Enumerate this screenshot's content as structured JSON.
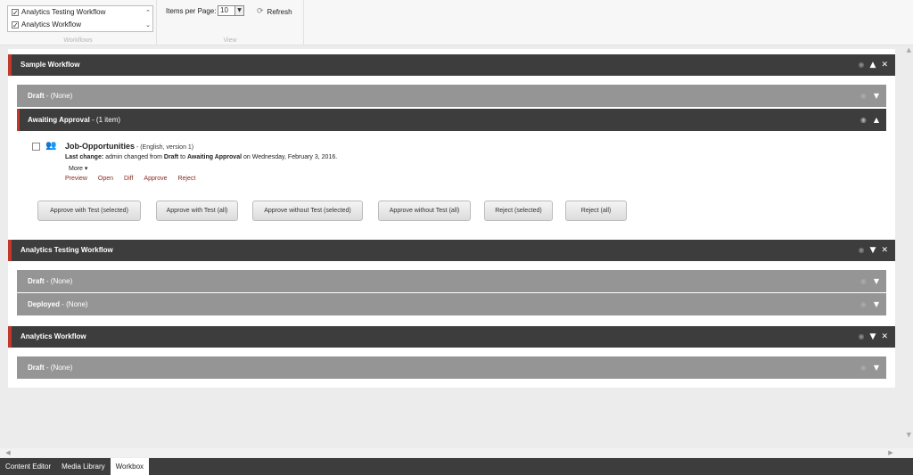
{
  "ribbon": {
    "workflows_list": [
      {
        "label": "Analytics Testing Workflow",
        "checked": true
      },
      {
        "label": "Analytics Workflow",
        "checked": true
      }
    ],
    "workflows_group_title": "Workflows",
    "items_per_page_label": "Items per Page:",
    "items_per_page_value": "10",
    "refresh_label": "Refresh",
    "view_group_title": "View"
  },
  "workflows": [
    {
      "title": "Sample Workflow",
      "states": [
        {
          "name": "Draft",
          "detail": " - (None)"
        },
        {
          "name": "Awaiting Approval",
          "detail": " - (1 item)"
        }
      ]
    },
    {
      "title": "Analytics Testing Workflow",
      "states": [
        {
          "name": "Draft",
          "detail": " - (None)"
        },
        {
          "name": "Deployed",
          "detail": " - (None)"
        }
      ]
    },
    {
      "title": "Analytics Workflow",
      "states": [
        {
          "name": "Draft",
          "detail": " - (None)"
        }
      ]
    }
  ],
  "item": {
    "name": "Job-Opportunities",
    "meta": " - (English, version 1)",
    "change_label": "Last change:",
    "change_user": " admin changed from ",
    "from_state": "Draft",
    "to_text": " to ",
    "to_state": "Awaiting Approval",
    "date_text": " on Wednesday, February 3, 2016.",
    "more_label": "More ▾",
    "actions": [
      "Preview",
      "Open",
      "Diff",
      "Approve",
      "Reject"
    ]
  },
  "buttons": [
    "Approve with Test (selected)",
    "Approve with Test (all)",
    "Approve without Test (selected)",
    "Approve without Test (all)",
    "Reject (selected)",
    "Reject (all)"
  ],
  "taskbar": {
    "tabs": [
      "Content Editor",
      "Media Library",
      "Workbox"
    ],
    "active": "Workbox"
  },
  "colors": {
    "accent": "#c0392b",
    "header_bg": "#3d3d3d",
    "state_bg": "#959595"
  }
}
